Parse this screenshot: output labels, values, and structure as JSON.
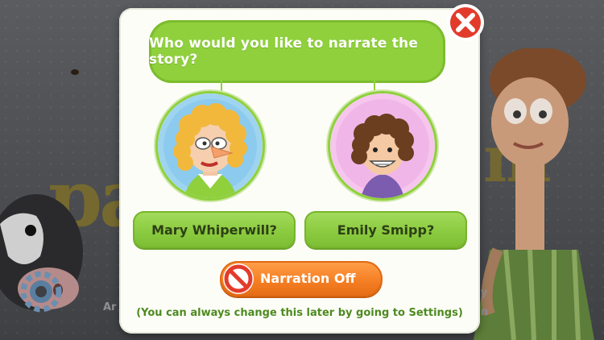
{
  "dialog": {
    "question": "Who would you like to narrate the story?",
    "narrators": [
      {
        "name": "Mary Whiperwill?"
      },
      {
        "name": "Emily Smipp?"
      }
    ],
    "narration_off_label": "Narration Off",
    "hint": "(You can always change this later by going to Settings)",
    "close_icon": "close-x-icon",
    "no_icon": "prohibited-icon"
  },
  "colors": {
    "bubble_green": "#8fd03c",
    "button_orange": "#f47d22",
    "close_red": "#e33b2b",
    "hint_green": "#4d8a1f"
  }
}
